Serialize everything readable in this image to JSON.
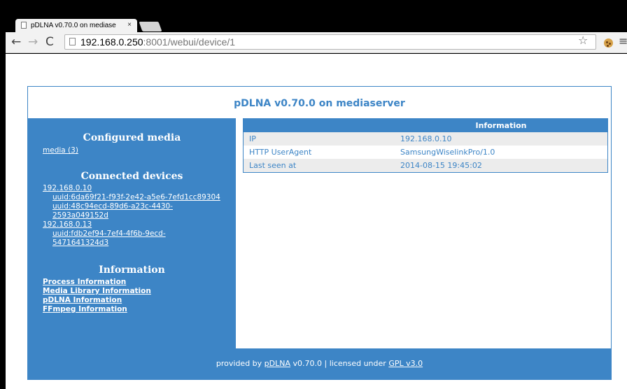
{
  "browser": {
    "tab_title": "pDLNA v0.70.0 on mediase",
    "url_host": "192.168.0.250",
    "url_rest": ":8001/webui/device/1"
  },
  "page": {
    "title": "pDLNA v0.70.0 on mediaserver"
  },
  "sidebar": {
    "configured_media_heading": "Configured media",
    "media_link": "media (3)",
    "connected_devices_heading": "Connected devices",
    "devices": [
      {
        "ip": "192.168.0.10",
        "uuids": [
          "uuid:6da69f21-f93f-2e42-a5e6-7efd1cc89304",
          "uuid:48c94ecd-89d6-a23c-4430-2593a049152d"
        ]
      },
      {
        "ip": "192.168.0.13",
        "uuids": [
          "uuid:fdb2ef94-7ef4-4f6b-9ecd-5471641324d3"
        ]
      }
    ],
    "information_heading": "Information",
    "info_links": [
      "Process Information",
      "Media Library Information",
      "pDLNA Information",
      "FFmpeg Information"
    ]
  },
  "info_table": {
    "header_left": "",
    "header_right": "Information",
    "rows": [
      {
        "label": "IP",
        "value": "192.168.0.10"
      },
      {
        "label": "HTTP UserAgent",
        "value": "SamsungWiselinkPro/1.0"
      },
      {
        "label": "Last seen at",
        "value": "2014-08-15 19:45:02"
      }
    ]
  },
  "footer": {
    "prefix": "provided by",
    "pdlna_link": "pDLNA",
    "middle": "v0.70.0 | licensed under",
    "license_link": "GPL v3.0"
  }
}
